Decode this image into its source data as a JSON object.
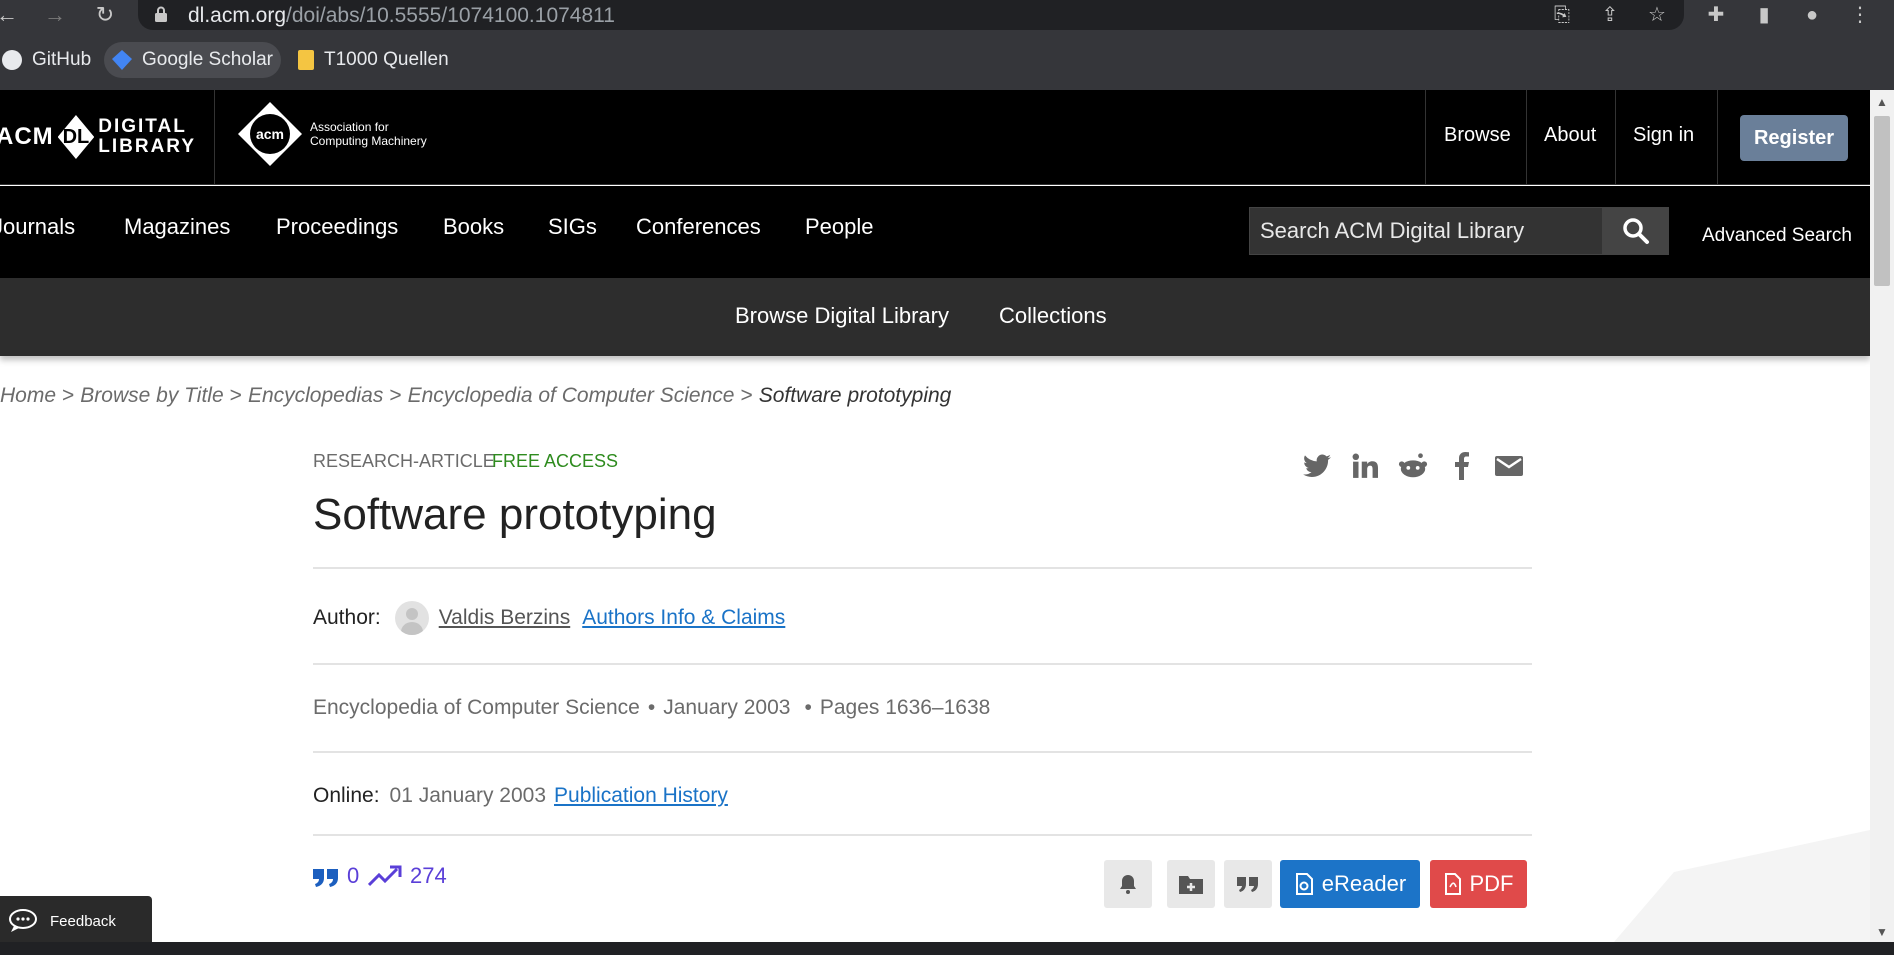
{
  "browser": {
    "url_host": "dl.acm.org",
    "url_path": "/doi/abs/10.5555/1074100.1074811"
  },
  "bookmarks": [
    {
      "label": "GitHub"
    },
    {
      "label": "Google Scholar"
    },
    {
      "label": "T1000 Quellen"
    }
  ],
  "header": {
    "logo_acm": "ACM",
    "logo_dl": "DL",
    "logo_words_1": "DIGITAL",
    "logo_words_2": "LIBRARY",
    "org_logo": "acm",
    "org_line1": "Association for",
    "org_line2": "Computing Machinery",
    "browse": "Browse",
    "about": "About",
    "sign_in": "Sign in",
    "register": "Register"
  },
  "nav": {
    "items": [
      "Journals",
      "Magazines",
      "Proceedings",
      "Books",
      "SIGs",
      "Conferences",
      "People"
    ],
    "search_placeholder": "Search ACM Digital Library",
    "advanced_search": "Advanced Search"
  },
  "subnav": {
    "browse_digital_library": "Browse Digital Library",
    "collections": "Collections"
  },
  "breadcrumb": {
    "items": [
      "Home",
      "Browse by Title",
      "Encyclopedias",
      "Encyclopedia of Computer Science"
    ],
    "current": "Software prototyping",
    "separator": ">"
  },
  "article": {
    "type": "RESEARCH-ARTICLE",
    "access": "FREE ACCESS",
    "title": "Software prototyping",
    "author_label": "Author:",
    "author_name": "Valdis Berzins",
    "authors_info": "Authors Info & Claims",
    "publication": "Encyclopedia of Computer Science",
    "date": "January 2003",
    "pages": "Pages 1636–1638",
    "bullet": "•",
    "online_label": "Online:",
    "online_date": "01 January 2003",
    "publication_history": "Publication History",
    "citations": "0",
    "downloads": "274",
    "ereader": "eReader",
    "pdf": "PDF"
  },
  "feedback": "Feedback",
  "colors": {
    "free_access": "#2e8b1e",
    "link_blue": "#1a73c7",
    "metric_purple": "#5a3fd8",
    "register_bg": "#6a7f99",
    "ereader_bg": "#1c74c8",
    "pdf_bg": "#e04a4a"
  }
}
